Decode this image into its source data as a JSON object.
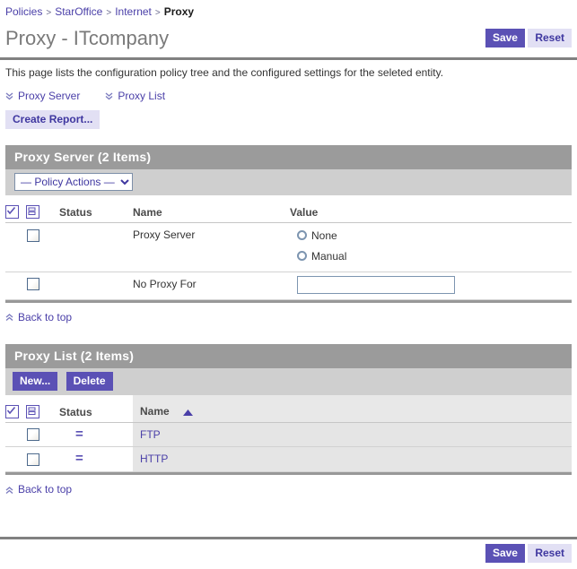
{
  "breadcrumb": {
    "separator": ">",
    "items": [
      {
        "label": "Policies",
        "current": false
      },
      {
        "label": "StarOffice",
        "current": false
      },
      {
        "label": "Internet",
        "current": false
      },
      {
        "label": "Proxy",
        "current": true
      }
    ]
  },
  "header": {
    "title": "Proxy - ITcompany",
    "save_label": "Save",
    "reset_label": "Reset",
    "description": "This page lists the configuration policy tree and the configured settings for the seleted entity."
  },
  "jump_links": [
    {
      "label": "Proxy Server",
      "icon": "chevron-double-down-icon"
    },
    {
      "label": "Proxy List",
      "icon": "chevron-double-down-icon"
    }
  ],
  "toolbar": {
    "create_report_label": "Create Report..."
  },
  "proxy_server_section": {
    "heading": "Proxy Server (2 Items)",
    "policy_actions_selected": "— Policy Actions —",
    "policy_actions_options": [
      "— Policy Actions —"
    ],
    "select_all_icon": "checkbox-checked-icon",
    "column_options_icon": "list-rows-icon",
    "columns": [
      "Status",
      "Name",
      "Value"
    ],
    "rows": [
      {
        "checked": false,
        "status": "",
        "name": "Proxy Server",
        "value_type": "radio-group",
        "radios": [
          {
            "label": "None",
            "selected": false
          },
          {
            "label": "Manual",
            "selected": false
          }
        ]
      },
      {
        "checked": false,
        "status": "",
        "name": "No Proxy For",
        "value_type": "text-input",
        "input_value": "",
        "input_placeholder": ""
      }
    ],
    "back_to_top_label": "Back to top",
    "back_to_top_icon": "chevron-double-up-icon"
  },
  "proxy_list_section": {
    "heading": "Proxy List (2 Items)",
    "new_label": "New...",
    "delete_label": "Delete",
    "select_all_icon": "checkbox-checked-icon",
    "column_options_icon": "list-rows-icon",
    "columns": [
      "Status",
      "Name"
    ],
    "sorted_column": "Name",
    "sort_direction": "ascending",
    "sort_icon": "triangle-up-icon",
    "rows": [
      {
        "checked": false,
        "status_icon": "equals-icon",
        "status": "=",
        "name": "FTP"
      },
      {
        "checked": false,
        "status_icon": "equals-icon",
        "status": "=",
        "name": "HTTP"
      }
    ],
    "back_to_top_label": "Back to top",
    "back_to_top_icon": "chevron-double-up-icon"
  },
  "footer": {
    "save_label": "Save",
    "reset_label": "Reset"
  },
  "colors": {
    "accent_purple": "#5b51b5",
    "link_purple": "#4a3fa8",
    "secondary_button": "#e2e0f4",
    "section_header_gray": "#9b9b9b",
    "action_bar_gray": "#cfcfcf"
  }
}
